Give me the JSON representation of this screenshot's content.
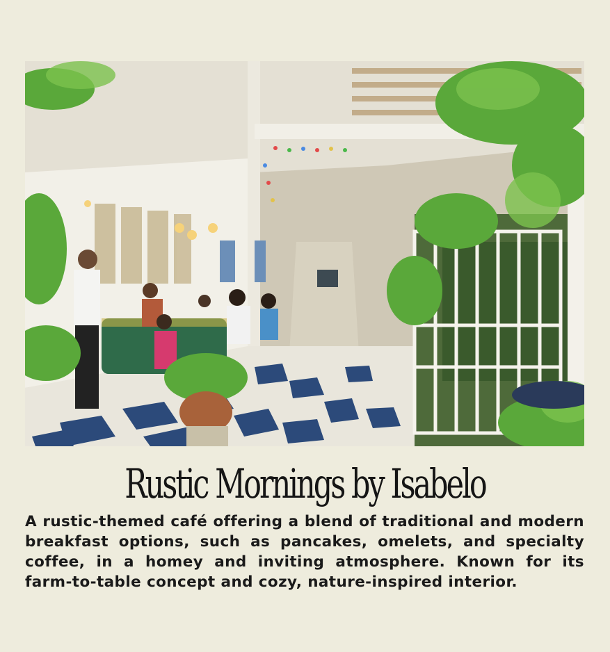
{
  "title": "Rustic Mornings by Isabelo",
  "description": "A rustic-themed café offering a blend of traditional and modern breakfast options, such as pancakes, omelets, and specialty coffee, in a homey and inviting atmosphere. Known for its farm-to-table concept and cozy, nature-inspired interior.",
  "colors": {
    "background": "#eeecdd",
    "text": "#151515"
  }
}
